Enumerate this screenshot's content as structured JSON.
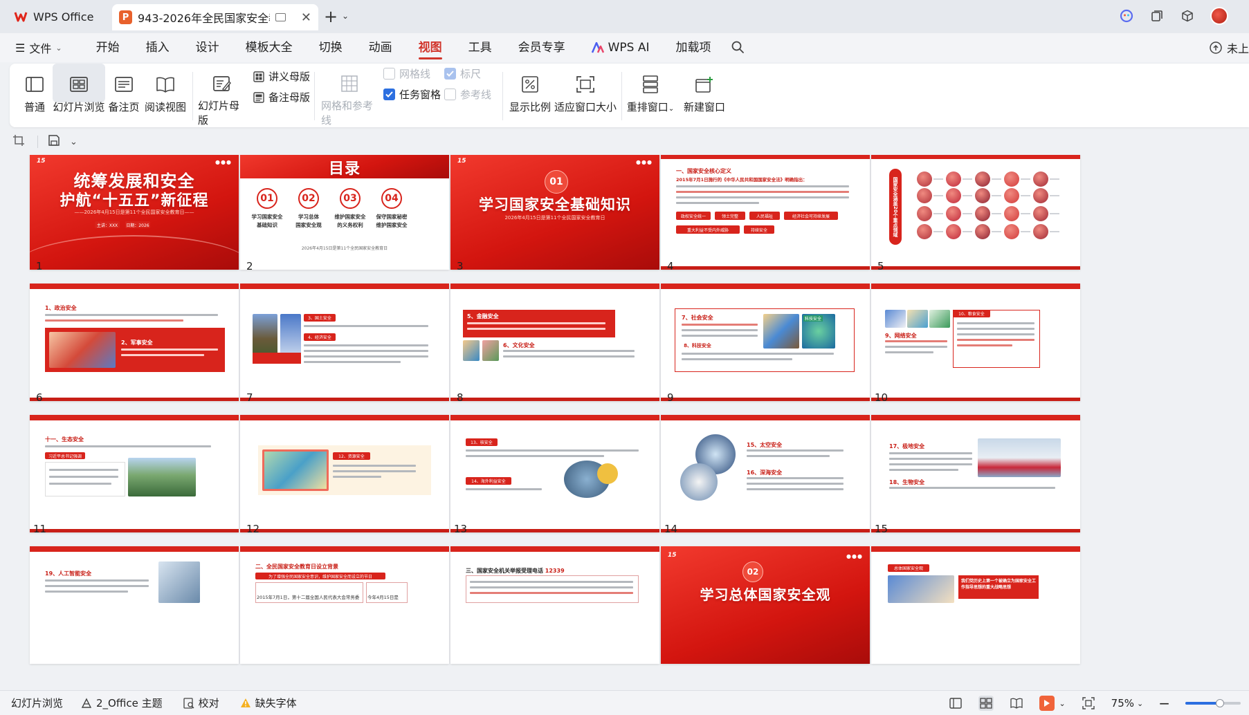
{
  "tabs": {
    "home_label": "WPS Office",
    "doc_title": "943-2026年全民国家安全教育"
  },
  "menu": {
    "file_label": "文件",
    "items": [
      "开始",
      "插入",
      "设计",
      "模板大全",
      "切换",
      "动画",
      "视图",
      "工具",
      "会员专享",
      "WPS AI",
      "加载项"
    ],
    "active": "视图",
    "cloud_label": "未上"
  },
  "ribbon": {
    "normal": "普通",
    "slide_browse": "幻灯片浏览",
    "notes_page": "备注页",
    "reading_view": "阅读视图",
    "slide_master": "幻灯片母版",
    "handout_master": "讲义母版",
    "notes_master": "备注母版",
    "grid_guides": "网格和参考线",
    "gridlines": "网格线",
    "ruler": "标尺",
    "task_pane": "任务窗格",
    "guides": "参考线",
    "zoom_ratio": "显示比例",
    "fit_window": "适应窗口大小",
    "rearrange": "重排窗口",
    "new_window": "新建窗口"
  },
  "slides": {
    "s1": {
      "title1": "统筹发展和安全",
      "title2": "护航“十五五”新征程",
      "subtitle": "——2026年4月15日是第11个全民国家安全教育日——",
      "field1": "主讲：XXX",
      "field2": "日期：2026"
    },
    "s2": {
      "title": "目录",
      "items": [
        {
          "num": "01",
          "l1": "学习国家安全",
          "l2": "基础知识"
        },
        {
          "num": "02",
          "l1": "学习总体",
          "l2": "国家安全观"
        },
        {
          "num": "03",
          "l1": "维护国家安全",
          "l2": "的义务权利"
        },
        {
          "num": "04",
          "l1": "保守国家秘密",
          "l2": "维护国家安全"
        }
      ],
      "footer": "2026年4月15日是第11个全民国家安全教育日"
    },
    "s3": {
      "num": "01",
      "title": "学习国家安全基础知识",
      "subtitle": "2026年4月15日是第11个全民国家安全教育日"
    },
    "s4": {
      "heading": "一、国家安全核心定义",
      "sub": "2015年7月1日施行的《中华人民共和国国家安全法》明确指出：",
      "pills": [
        "政权安全统一",
        "领土完整",
        "人民福祉",
        "经济社会可持续发展",
        "重大利益不受内外威胁",
        "持续安全"
      ]
    },
    "s5": {
      "vertical": "国家安全涵盖20个重点领域"
    },
    "s6": {
      "h1": "1、政治安全",
      "h2": "2、军事安全"
    },
    "s7": {
      "h1": "3、国土安全",
      "h2": "4、经济安全"
    },
    "s8": {
      "h1": "5、金融安全",
      "h2": "6、文化安全"
    },
    "s9": {
      "h1": "7、社会安全",
      "h2": "8、科技安全",
      "img_label": "科技安全"
    },
    "s10": {
      "h1": "9、网络安全",
      "h2": "10、粮食安全"
    },
    "s11": {
      "h1": "十一、生态安全",
      "h2": "习近平总书记强调"
    },
    "s12": {
      "h1": "12、资源安全"
    },
    "s13": {
      "h1": "13、核安全",
      "h2": "14、海外利益安全"
    },
    "s14": {
      "h1": "15、太空安全",
      "h2": "16、深海安全"
    },
    "s15": {
      "h1": "17、极地安全",
      "h2": "18、生物安全"
    },
    "s16": {
      "h1": "19、人工智能安全"
    },
    "s17": {
      "heading": "二、全民国家安全教育日设立背景",
      "sub": "为了增强全民国家安全意识，维护国家安全而设立的节日",
      "col1": "2015年7月1日，第十二届全国人民代表大会常务委",
      "col2": "今年4月15日是"
    },
    "s18": {
      "heading": "三、国家安全机关举报受理电话",
      "phone": "12339"
    },
    "s19": {
      "num": "02",
      "title": "学习总体国家安全观"
    },
    "s20": {
      "h1": "总体国家安全观",
      "box": "我们党历史上第一个被确立为国家安全工作指导思想的重大战略思想"
    }
  },
  "slide_numbers": [
    "1",
    "2",
    "3",
    "4",
    "5",
    "6",
    "7",
    "8",
    "9",
    "10",
    "11",
    "12",
    "13",
    "14",
    "15"
  ],
  "status": {
    "view_label": "幻灯片浏览",
    "theme_label": "2_Office 主题",
    "proof_label": "校对",
    "missing_font": "缺失字体",
    "zoom": "75%"
  },
  "colors": {
    "accent_red": "#d8241c",
    "active_menu": "#d1352b",
    "checkbox_blue": "#2c6fe0"
  }
}
